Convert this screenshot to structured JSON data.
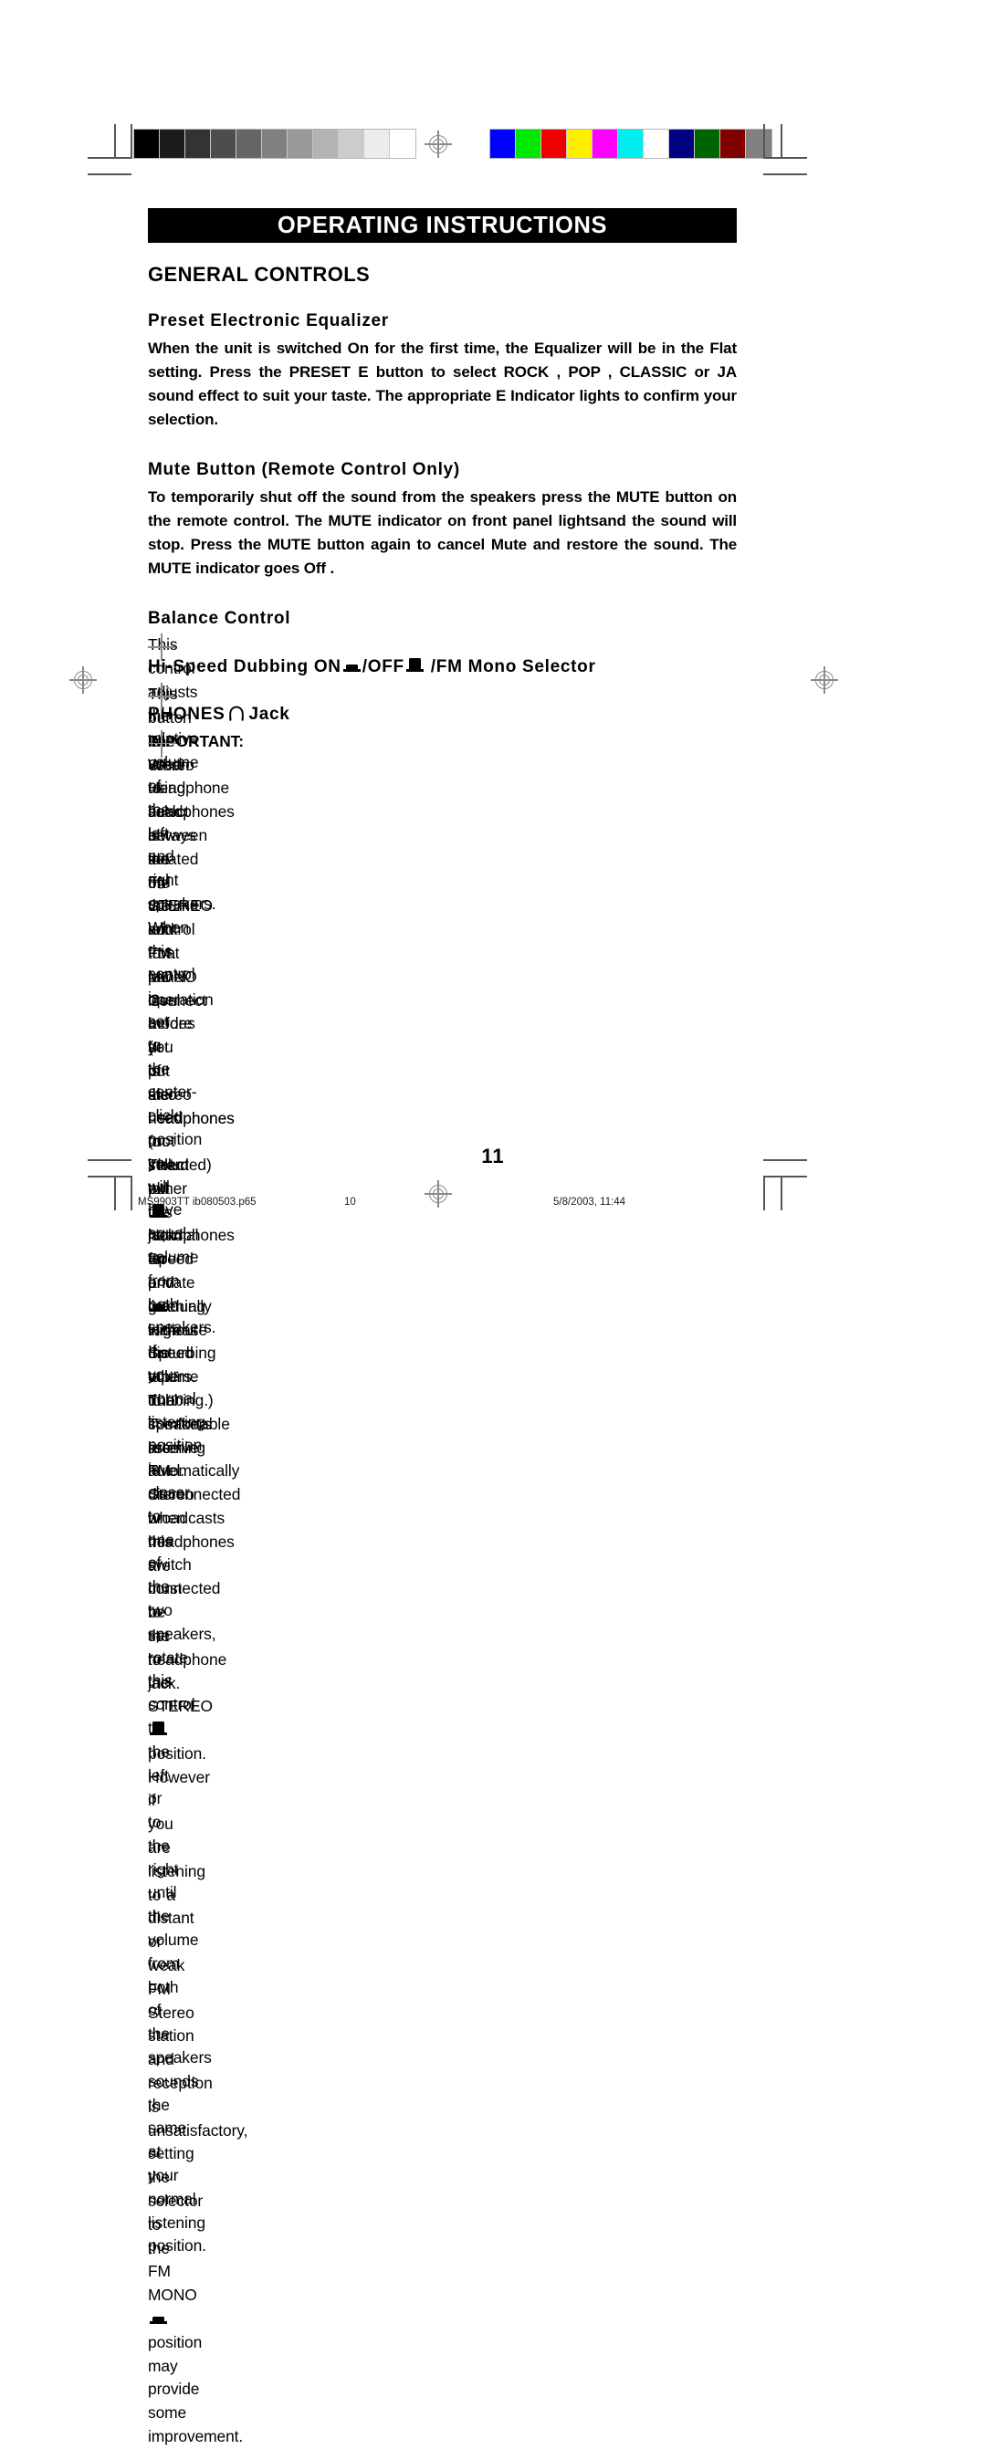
{
  "calibration": {
    "grayscale_label": "grayscale-calibration-strip",
    "grayscale_swatches": [
      "#000000",
      "#1c1c1c",
      "#333333",
      "#4d4d4d",
      "#666666",
      "#808080",
      "#999999",
      "#b3b3b3",
      "#cccccc",
      "#ececec",
      "#ffffff"
    ],
    "color_label": "color-calibration-strip",
    "color_swatches": [
      "#0000ff",
      "#00e800",
      "#ee0000",
      "#ffee00",
      "#ff00ff",
      "#00eeee",
      "#ffffff",
      "#000080",
      "#006400",
      "#800000",
      "#808080"
    ]
  },
  "header": {
    "title": "OPERATING INSTRUCTIONS",
    "section_title": "GENERAL CONTROLS"
  },
  "sections": {
    "equalizer": {
      "heading": "Preset Electronic Equalizer",
      "body": "When the unit is switched  On  for the first time, the Equalizer will be in the   Flat  setting. Press the PRESET E    button to select   ROCK ,  POP ,  CLASSIC  or   JA      sound effect to suit your taste. The appropriate E    Indicator lights to confirm your selection."
    },
    "mute": {
      "heading": "Mute Button (Remote Control Only)",
      "body": "To temporarily shut off the sound from the speakers press the MUTE button on the remote control. The MUTE indicator on front panel lightsand the sound will stop. Press the MUTE button again to cancel Mute and restore the sound. The MUTE indicator goes  Off ."
    },
    "balance": {
      "heading": "Balance Control",
      "body": "This control adjusts the relative volume of the left and right speakers. When this control is set to the center-click position you will have equal volume from both speakers. If your normal listening position is closer to one of the two speakers, rotate this control to the left or to the right until the volume from both of the speakers sounds the same at your normal listening position."
    },
    "dubbing": {
      "heading_part1": "Hi-Speed Dubbing  ON",
      "heading_part2": "/OFF",
      "heading_part3": " /FM Mono Selector",
      "icon_on": "switch-low-icon",
      "icon_off": "switch-high-icon",
      "body_1": "This button is used to select between the FM STEREO and FM MONO operation modes (It is also used to select either ",
      "body_2": " Normal Speed or ",
      "body_3": " High Speed tape dubbing.) To receive FM Stereo broadcasts this switch must be set to the STEREO ",
      "body_4": " position. However if you are listening to a distant or weak FM Stereo station and reception is unsatisfactory, setting the selector to the FM MONO ",
      "body_5": " position may provide some improvement."
    },
    "phones": {
      "heading_part1": "PHONES",
      "heading_part2": "Jack",
      "icon": "headphones-icon",
      "body_1": "The Stereo Headphone Jack is located on the left front panel. Connect a set of stereo headphones (not included) to this jack for private listening without disturbing others. The speakers are automatically disconnected when headphones are connected to the headphone jack.",
      "important_label": "IMPORTANT:",
      "important_body": " When using headphones always set the volume control to a low level before you put the headphones on. Then put the headphones on and gradually increase the volume to a comfortable listening level."
    }
  },
  "page_number": "11",
  "footer": {
    "file": "MS9903TT  ib080503.p65",
    "page": "10",
    "date": "5/8/2003, 11:44"
  }
}
